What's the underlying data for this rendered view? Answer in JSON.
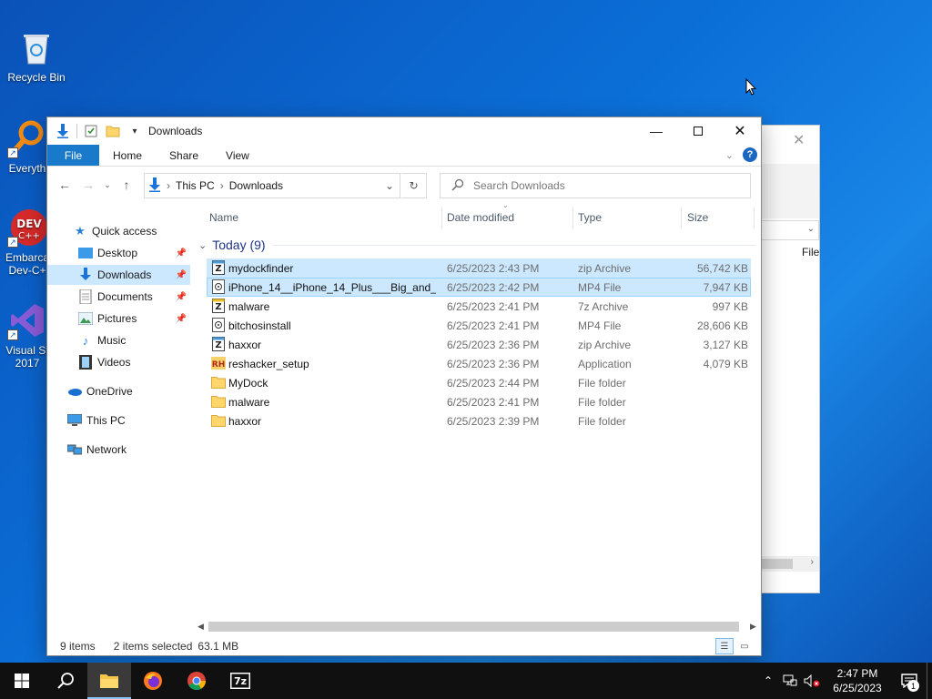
{
  "desktop": {
    "icons": [
      {
        "label": "Recycle Bin"
      },
      {
        "label": "Everyth"
      },
      {
        "label": "Embarca",
        "label2": "Dev-C+"
      },
      {
        "label": "Visual St",
        "label2": "2017"
      }
    ]
  },
  "bg_window": {
    "partial_text": "File"
  },
  "window": {
    "title": "Downloads",
    "ribbon": {
      "file": "File",
      "home": "Home",
      "share": "Share",
      "view": "View"
    },
    "address": {
      "this_pc": "This PC",
      "folder": "Downloads"
    },
    "search_placeholder": "Search Downloads",
    "nav_pane": {
      "quick_access": "Quick access",
      "desktop": "Desktop",
      "downloads": "Downloads",
      "documents": "Documents",
      "pictures": "Pictures",
      "music": "Music",
      "videos": "Videos",
      "onedrive": "OneDrive",
      "this_pc": "This PC",
      "network": "Network"
    },
    "columns": {
      "name": "Name",
      "date": "Date modified",
      "type": "Type",
      "size": "Size"
    },
    "group_label": "Today (9)",
    "files": [
      {
        "name": "mydockfinder",
        "date": "6/25/2023 2:43 PM",
        "type": "zip Archive",
        "size": "56,742 KB"
      },
      {
        "name": "iPhone_14__iPhone_14_Plus___Big_and_Bi...",
        "date": "6/25/2023 2:42 PM",
        "type": "MP4 File",
        "size": "7,947 KB"
      },
      {
        "name": "malware",
        "date": "6/25/2023 2:41 PM",
        "type": "7z Archive",
        "size": "997 KB"
      },
      {
        "name": "bitchosinstall",
        "date": "6/25/2023 2:41 PM",
        "type": "MP4 File",
        "size": "28,606 KB"
      },
      {
        "name": "haxxor",
        "date": "6/25/2023 2:36 PM",
        "type": "zip Archive",
        "size": "3,127 KB"
      },
      {
        "name": "reshacker_setup",
        "date": "6/25/2023 2:36 PM",
        "type": "Application",
        "size": "4,079 KB"
      },
      {
        "name": "MyDock",
        "date": "6/25/2023 2:44 PM",
        "type": "File folder",
        "size": ""
      },
      {
        "name": "malware",
        "date": "6/25/2023 2:41 PM",
        "type": "File folder",
        "size": ""
      },
      {
        "name": "haxxor",
        "date": "6/25/2023 2:39 PM",
        "type": "File folder",
        "size": ""
      }
    ],
    "status": {
      "items": "9 items",
      "selected": "2 items selected",
      "size": "63.1 MB"
    }
  },
  "taskbar": {
    "time": "2:47 PM",
    "date": "6/25/2023",
    "notification_count": "1"
  },
  "colors": {
    "accent": "#1979ca",
    "selection": "#cce8ff",
    "taskbar": "#101010"
  }
}
